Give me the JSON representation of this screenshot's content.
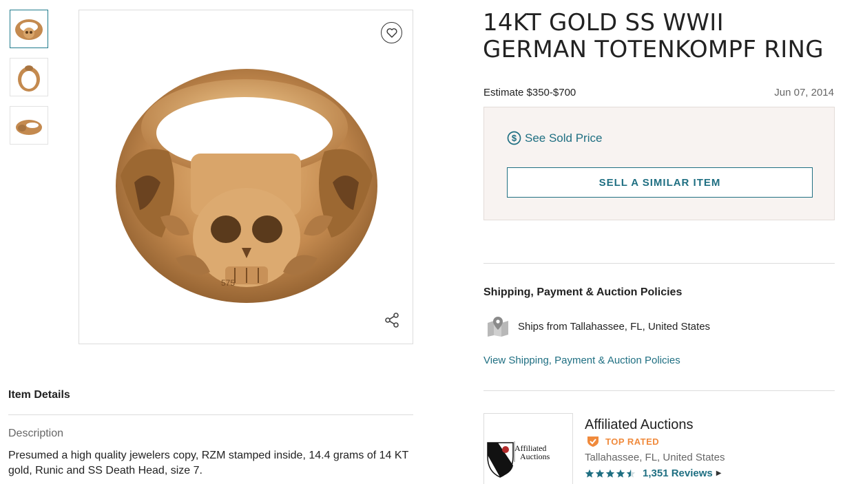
{
  "gallery": {
    "thumbnails": [
      {
        "name": "ring-front-thumbnail",
        "active": true
      },
      {
        "name": "ring-inside-thumbnail",
        "active": false
      },
      {
        "name": "ring-side-thumbnail",
        "active": false
      }
    ],
    "favorite_icon": "heart-icon",
    "share_icon": "share-icon",
    "stamp_text": "575"
  },
  "item_details": {
    "heading": "Item Details",
    "description_label": "Description",
    "description_text": "Presumed a high quality jewelers copy, RZM stamped inside, 14.4 grams of 14 KT gold, Runic and  SS Death Head, size 7."
  },
  "lot": {
    "title": "14KT GOLD SS WWII GERMAN TOTENKOMPF RING",
    "estimate": "Estimate $350-$700",
    "date": "Jun 07, 2014"
  },
  "sold_box": {
    "see_sold_label": "See Sold Price",
    "see_sold_icon": "dollar-circle-icon",
    "sell_button": "SELL A SIMILAR ITEM"
  },
  "shipping": {
    "heading": "Shipping, Payment & Auction Policies",
    "ships_from": "Ships from Tallahassee, FL, United States",
    "ships_icon": "map-pin-icon",
    "link": "View Shipping, Payment & Auction Policies"
  },
  "auction_house": {
    "logo_text_line1": "Affiliated",
    "logo_text_line2": "Auctions",
    "name": "Affiliated Auctions",
    "badge": "TOP RATED",
    "location": "Tallahassee, FL, United States",
    "rating": 4.5,
    "reviews": "1,351 Reviews"
  },
  "colors": {
    "accent": "#1f6f82",
    "top_rated": "#f08a3c",
    "sold_box_bg": "#f8f3f1",
    "gold": "#c48a4f"
  }
}
